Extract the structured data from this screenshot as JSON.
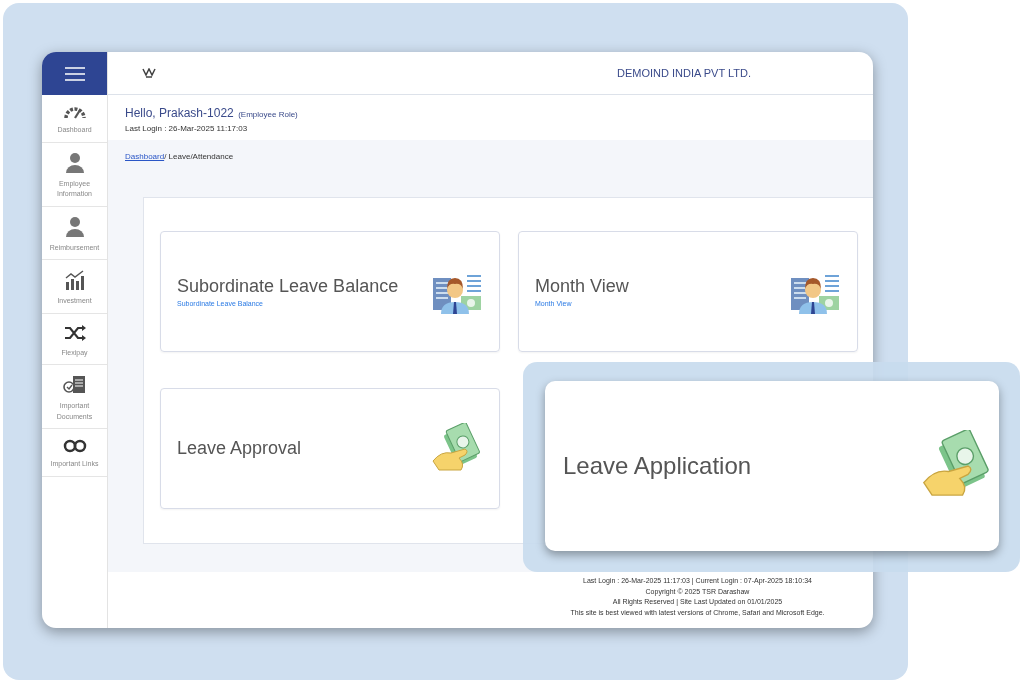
{
  "header": {
    "company": "DEMOIND INDIA PVT LTD."
  },
  "sidebar": {
    "items": [
      {
        "label": "Dashboard",
        "kind": "gauge"
      },
      {
        "label": "Employee Information",
        "kind": "person"
      },
      {
        "label": "Reimbursement",
        "kind": "person"
      },
      {
        "label": "Investment",
        "kind": "chart"
      },
      {
        "label": "Flexipay",
        "kind": "shuffle"
      },
      {
        "label": "Important Documents",
        "kind": "document"
      },
      {
        "label": "Important Links",
        "kind": "link"
      }
    ]
  },
  "greeting": {
    "name": "Hello, Prakash-1022",
    "role": "(Employee Role)",
    "last_login": "Last Login : 26-Mar-2025 11:17:03"
  },
  "breadcrumb": {
    "link": "Dashboard",
    "current": "/ Leave/Attendance"
  },
  "cards": [
    {
      "title": "Subordinate Leave Balance",
      "subtitle": "Subordinate Leave Balance",
      "kind": "employee"
    },
    {
      "title": "Month View",
      "subtitle": "Month View",
      "kind": "employee"
    },
    {
      "title": "Leave Approval",
      "kind": "cash"
    }
  ],
  "highlight_card": {
    "title": "Leave Application",
    "kind": "cash"
  },
  "footer": [
    "Last Login : 26-Mar-2025 11:17:03 | Current Login : 07-Apr-2025 18:10:34",
    "Copyright © 2025 TSR Darashaw",
    "All Rights Reserved | Site Last Updated on 01/01/2025",
    "This site is best viewed with latest versions of Chrome, Safari and Microsoft Edge."
  ]
}
